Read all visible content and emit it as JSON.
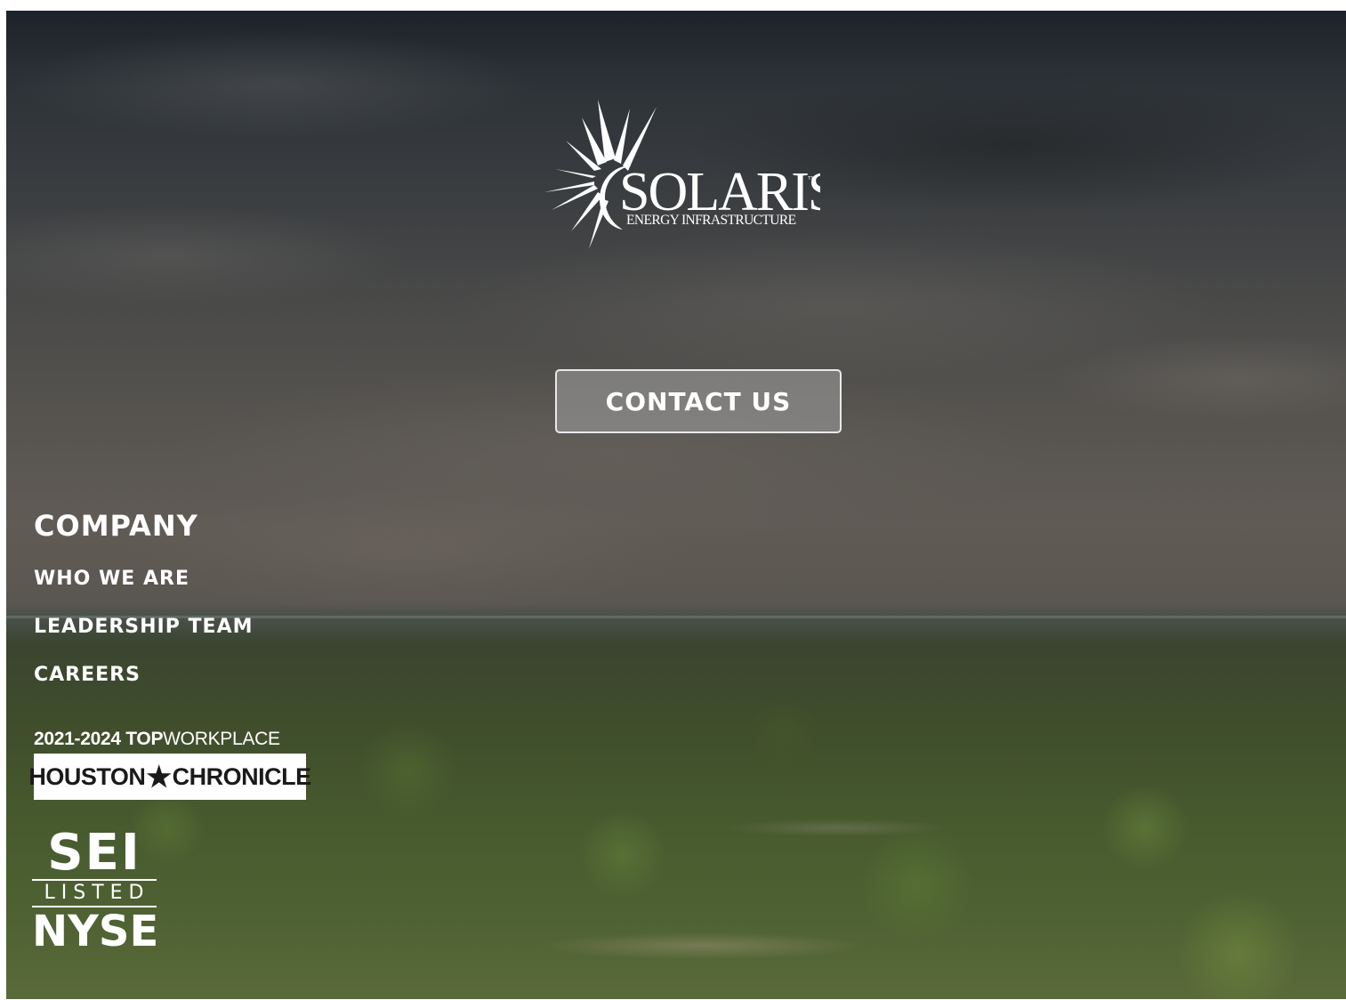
{
  "logo": {
    "name": "SOLARIS",
    "tagline": "ENERGY INFRASTRUCTURE",
    "trademark": "™"
  },
  "cta": {
    "label": "CONTACT US"
  },
  "company": {
    "heading": "COMPANY",
    "links": [
      {
        "label": "WHO WE ARE"
      },
      {
        "label": "LEADERSHIP TEAM"
      },
      {
        "label": "CAREERS"
      }
    ]
  },
  "award": {
    "years": "2021-2024",
    "top": "TOP",
    "workplace": "WORKPLACE",
    "publisher_left": "HOUSTON",
    "publisher_right": "CHRONICLE"
  },
  "listing": {
    "symbol": "SEI",
    "listed": "LISTED",
    "exchange": "NYSE"
  }
}
